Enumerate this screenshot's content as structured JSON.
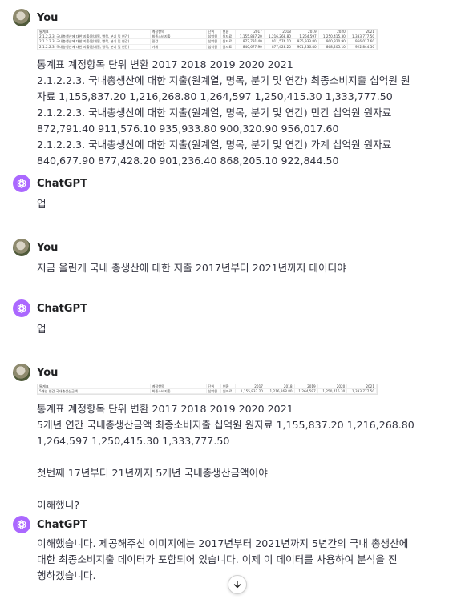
{
  "messages": [
    {
      "author": "You",
      "thumbnail": {
        "header": [
          "통계표",
          "계정항목",
          "단위",
          "변환",
          "2017",
          "2018",
          "2019",
          "2020",
          "2021"
        ],
        "rows": [
          [
            "2.1.2.2.3. 국내총생산에 대한 지출(원계열, 명목, 분기 및 연간)",
            "최종소비지출",
            "십억원",
            "원자료",
            "1,155,837.20",
            "1,216,268.80",
            "1,264,597",
            "1,250,415.30",
            "1,333,777.50"
          ],
          [
            "2.1.2.2.3. 국내총생산에 대한 지출(원계열, 명목, 분기 및 연간)",
            "민간",
            "십억원",
            "원자료",
            "872,791.40",
            "911,576.10",
            "935,933.80",
            "900,320.90",
            "956,017.60"
          ],
          [
            "2.1.2.2.3. 국내총생산에 대한 지출(원계열, 명목, 분기 및 연간)",
            "가계",
            "십억원",
            "원자료",
            "840,677.90",
            "877,428.20",
            "901,236.40",
            "868,205.10",
            "922,844.50"
          ]
        ]
      },
      "lines": [
        "통계표 계정항목 단위 변환 2017 2018 2019 2020 2021",
        "2.1.2.2.3. 국내총생산에 대한 지출(원계열, 명목, 분기 및 연간)   최종소비지출   십억원 원",
        "자료 1,155,837.20   1,216,268.80   1,264,597   1,250,415.30   1,333,777.50",
        "2.1.2.2.3. 국내총생산에 대한 지출(원계열, 명목, 분기 및 연간)      민간 십억원 원자료",
        "872,791.40  911,576.10   935,933.80   900,320.90   956,017.60",
        "2.1.2.2.3. 국내총생산에 대한 지출(원계열, 명목, 분기 및 연간)      가계  십억원  원자료",
        "840,677.90 877,428.20 901,236.40 868,205.10 922,844.50"
      ]
    },
    {
      "author": "ChatGPT",
      "lines": [
        "업"
      ]
    },
    {
      "author": "You",
      "lines": [
        "지금 올린게 국내 총생산에 대한 지출 2017년부터 2021년까지 데이터야"
      ]
    },
    {
      "author": "ChatGPT",
      "lines": [
        "업"
      ]
    },
    {
      "author": "You",
      "thumbnail": {
        "header": [
          "통계표",
          "계정항목",
          "단위",
          "변환",
          "2017",
          "2018",
          "2019",
          "2020",
          "2021"
        ],
        "rows": [
          [
            "5개년 연간 국내총생산금액",
            "최종소비지출",
            "십억원",
            "원자료",
            "1,155,837.20",
            "1,216,268.80",
            "1,264,597",
            "1,250,415.30",
            "1,333,777.50"
          ]
        ]
      },
      "lines": [
        "통계표 계정항목 단위 변환 2017 2018 2019 2020 2021",
        "5개년 연간 국내총생산금액   최종소비지출   십억원 원자료 1,155,837.20   1,216,268.80",
        "1,264,597   1,250,415.30   1,333,777.50",
        "",
        "첫번째 17년부터 21년까지 5개년 국내총생산금액이야",
        "",
        "이해했니?"
      ]
    },
    {
      "author": "ChatGPT",
      "lines": [
        "이해했습니다. 제공해주신 이미지에는 2017년부터 2021년까지 5년간의 국내 총생산에",
        "대한 최종소비지출 데이터가 포함되어 있습니다. 이제 이 데이터를 사용하여 분석을 진",
        "행하겠습니다."
      ]
    }
  ],
  "icons": {
    "scroll": "arrow-down-icon",
    "gpt_logo": "openai-logo-icon"
  }
}
